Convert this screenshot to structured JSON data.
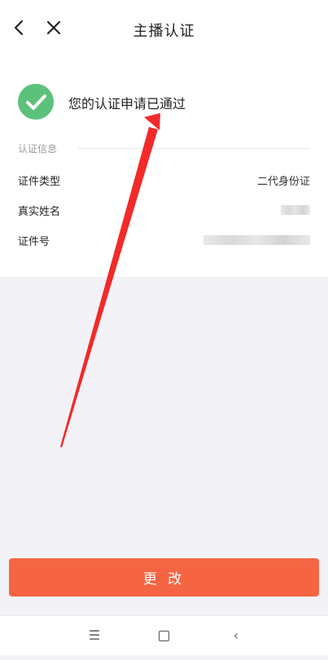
{
  "header": {
    "title": "主播认证"
  },
  "status": {
    "text": "您的认证申请已通过"
  },
  "info": {
    "section_title": "认证信息",
    "rows": [
      {
        "label": "证件类型",
        "value": "二代身份证"
      },
      {
        "label": "真实姓名",
        "value": ""
      },
      {
        "label": "证件号",
        "value": ""
      }
    ]
  },
  "actions": {
    "change_label": "更 改"
  },
  "colors": {
    "accent": "#f56543",
    "success": "#5cc17b",
    "annotation_arrow": "#f22a2a"
  }
}
